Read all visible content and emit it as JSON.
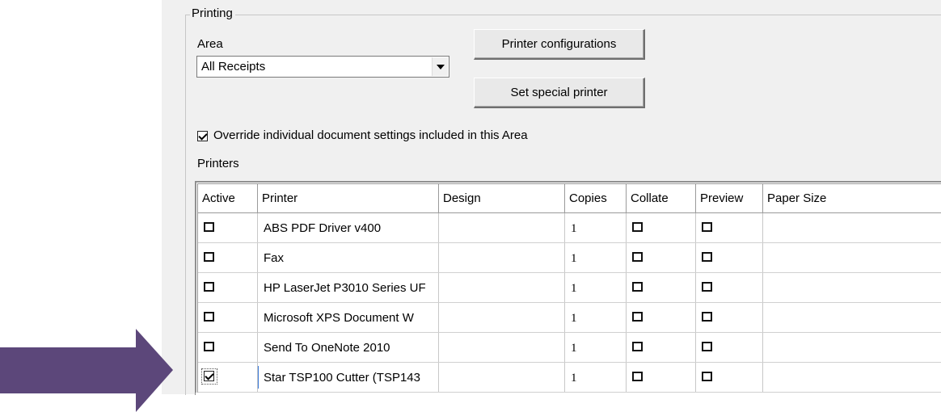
{
  "printing_group": {
    "title": "Printing",
    "area_label": "Area",
    "area_value": "All Receipts",
    "printer_config_button": "Printer configurations",
    "special_printer_button": "Set special printer",
    "override_checked": true,
    "override_label": "Override individual document settings included in this Area",
    "printers_label": "Printers"
  },
  "printers_table": {
    "columns": [
      "Active",
      "Printer",
      "Design",
      "Copies",
      "Collate",
      "Preview",
      "Paper Size"
    ],
    "rows": [
      {
        "active": false,
        "printer": "ABS PDF Driver v400",
        "design": "",
        "copies": "1",
        "collate": false,
        "preview": false,
        "paper_size": ""
      },
      {
        "active": false,
        "printer": "Fax",
        "design": "",
        "copies": "1",
        "collate": false,
        "preview": false,
        "paper_size": ""
      },
      {
        "active": false,
        "printer": "HP LaserJet P3010 Series UF",
        "design": "",
        "copies": "1",
        "collate": false,
        "preview": false,
        "paper_size": ""
      },
      {
        "active": false,
        "printer": "Microsoft XPS Document W",
        "design": "",
        "copies": "1",
        "collate": false,
        "preview": false,
        "paper_size": ""
      },
      {
        "active": false,
        "printer": "Send To OneNote 2010",
        "design": "",
        "copies": "1",
        "collate": false,
        "preview": false,
        "paper_size": ""
      },
      {
        "active": true,
        "printer": "Star TSP100 Cutter (TSP143",
        "design": "",
        "copies": "1",
        "collate": false,
        "preview": false,
        "paper_size": ""
      }
    ]
  },
  "annotation": {
    "arrow_color": "#5c477a"
  },
  "icons": [
    "checkbox-icon",
    "dropdown-arrow-icon",
    "pointer-arrow-icon"
  ]
}
